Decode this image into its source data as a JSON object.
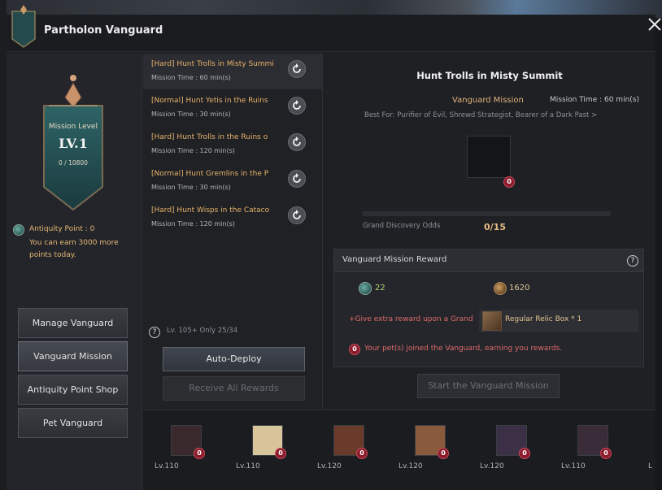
{
  "window": {
    "title": "Partholon Vanguard"
  },
  "level_banner": {
    "label": "Mission Level",
    "level": "LV.1",
    "exp": "0 / 10800"
  },
  "antiquity": {
    "title": "Antiquity Point : 0",
    "description": "You can earn 3000 more points today."
  },
  "side_menu": [
    {
      "label": "Manage Vanguard",
      "active": false
    },
    {
      "label": "Vanguard Mission",
      "active": true
    },
    {
      "label": "Antiquity Point Shop",
      "active": false
    },
    {
      "label": "Pet Vanguard",
      "active": false
    }
  ],
  "missions": [
    {
      "name": "[Hard] Hunt Trolls in Misty Summi",
      "time": "Mission Time : 60 min(s)",
      "selected": true
    },
    {
      "name": "[Normal] Hunt Yetis in the Ruins",
      "time": "Mission Time : 30 min(s)",
      "selected": false
    },
    {
      "name": "[Hard] Hunt Trolls in the Ruins o",
      "time": "Mission Time : 120 min(s)",
      "selected": false
    },
    {
      "name": "[Normal] Hunt Gremlins in the P",
      "time": "Mission Time : 30 min(s)",
      "selected": false
    },
    {
      "name": "[Hard] Hunt Wisps in the Cataco",
      "time": "Mission Time : 120 min(s)",
      "selected": false
    }
  ],
  "list_footer": {
    "help": "?",
    "only_text": "Lv. 105+ Only 25/34",
    "auto_deploy": "Auto-Deploy",
    "receive_all": "Receive All Rewards"
  },
  "detail": {
    "title": "Hunt Trolls in Misty Summit",
    "mission_type": "Vanguard Mission",
    "mission_time": "Mission Time : 60 min(s)",
    "best_for": "Best For: Purifier of Evil, Shrewd Strategist, Bearer of a Dark Past >",
    "slot_count": "0",
    "odds_label": "Grand Discovery Odds",
    "odds_value": "0/15",
    "odds_fraction": 0
  },
  "reward": {
    "title": "Vanguard Mission Reward",
    "help": "?",
    "antiquity_value": "22",
    "exp_value": "1620",
    "extra_text": "+Give extra reward upon a Grand",
    "relic": "Regular Relic Box * 1",
    "pet_badge": "0",
    "pet_note": "Your pet(s) joined the Vanguard, earning you rewards."
  },
  "start_button": "Start the Vanguard Mission",
  "pets": [
    {
      "level": "Lv.110",
      "badge": "0",
      "color": "#3a2a2e"
    },
    {
      "level": "Lv.110",
      "badge": "0",
      "color": "#d8c49a"
    },
    {
      "level": "Lv.120",
      "badge": "0",
      "color": "#6a3a2a"
    },
    {
      "level": "Lv.120",
      "badge": "0",
      "color": "#8a5a3c"
    },
    {
      "level": "Lv.120",
      "badge": "0",
      "color": "#3c3046"
    },
    {
      "level": "Lv.110",
      "badge": "0",
      "color": "#3a2c38"
    }
  ],
  "pets_overflow": "L"
}
